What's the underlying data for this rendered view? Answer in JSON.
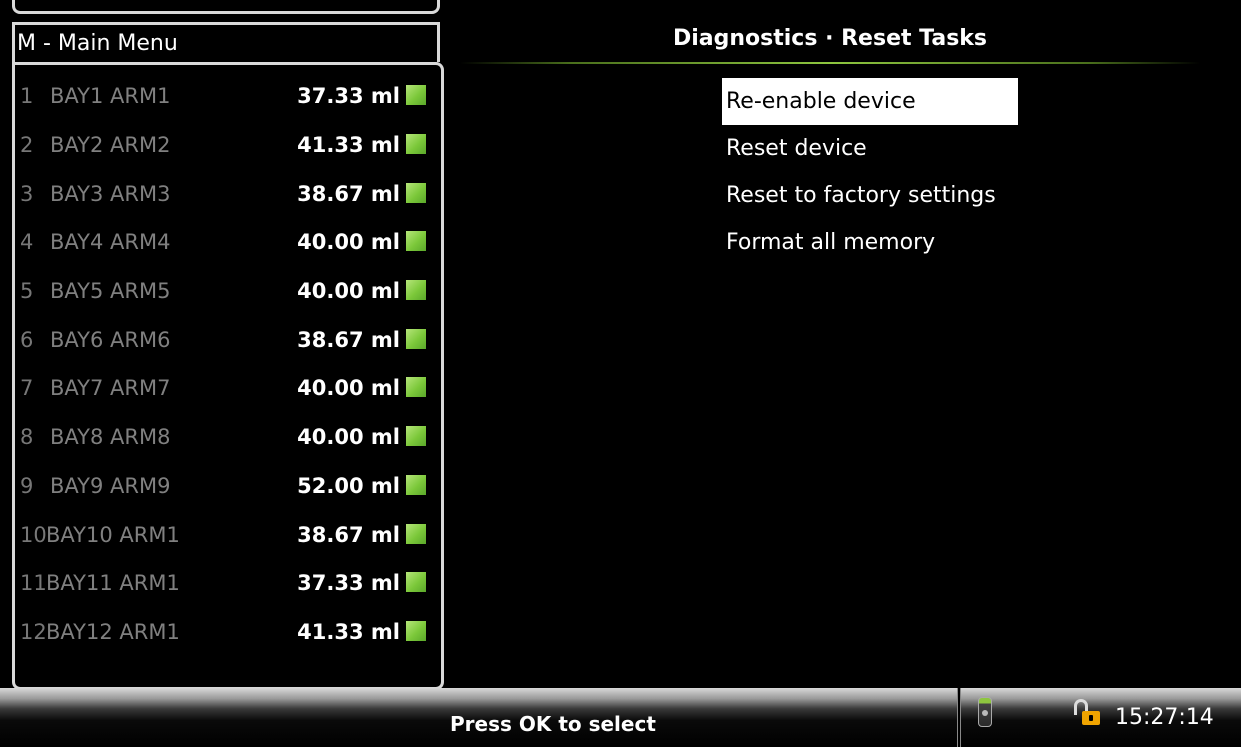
{
  "left_panel": {
    "menu_label": "M - Main Menu",
    "arms": [
      {
        "num": "1",
        "name": "BAY1 ARM1",
        "volume": "37.33 ml"
      },
      {
        "num": "2",
        "name": "BAY2 ARM2",
        "volume": "41.33 ml"
      },
      {
        "num": "3",
        "name": "BAY3 ARM3",
        "volume": "38.67 ml"
      },
      {
        "num": "4",
        "name": "BAY4 ARM4",
        "volume": "40.00 ml"
      },
      {
        "num": "5",
        "name": "BAY5 ARM5",
        "volume": "40.00 ml"
      },
      {
        "num": "6",
        "name": "BAY6 ARM6",
        "volume": "38.67 ml"
      },
      {
        "num": "7",
        "name": "BAY7 ARM7",
        "volume": "40.00 ml"
      },
      {
        "num": "8",
        "name": "BAY8 ARM8",
        "volume": "40.00 ml"
      },
      {
        "num": "9",
        "name": "BAY9 ARM9",
        "volume": "52.00 ml"
      },
      {
        "num": "10",
        "name": "BAY10 ARM1",
        "volume": "38.67 ml"
      },
      {
        "num": "11",
        "name": "BAY11 ARM1",
        "volume": "37.33 ml"
      },
      {
        "num": "12",
        "name": "BAY12 ARM1",
        "volume": "41.33 ml"
      }
    ],
    "status_color": "#7cc83a"
  },
  "right_panel": {
    "title": "Diagnostics · Reset Tasks",
    "tasks": [
      {
        "label": "Re-enable device",
        "selected": true
      },
      {
        "label": "Reset device",
        "selected": false
      },
      {
        "label": "Reset to factory settings",
        "selected": false
      },
      {
        "label": "Format all memory",
        "selected": false
      }
    ],
    "accent_color": "#8ec63f"
  },
  "status_bar": {
    "prompt": "Press OK to select",
    "device_icon": "handheld-device-icon",
    "lock_icon": "unlocked-padlock-icon",
    "time": "15:27:14"
  }
}
